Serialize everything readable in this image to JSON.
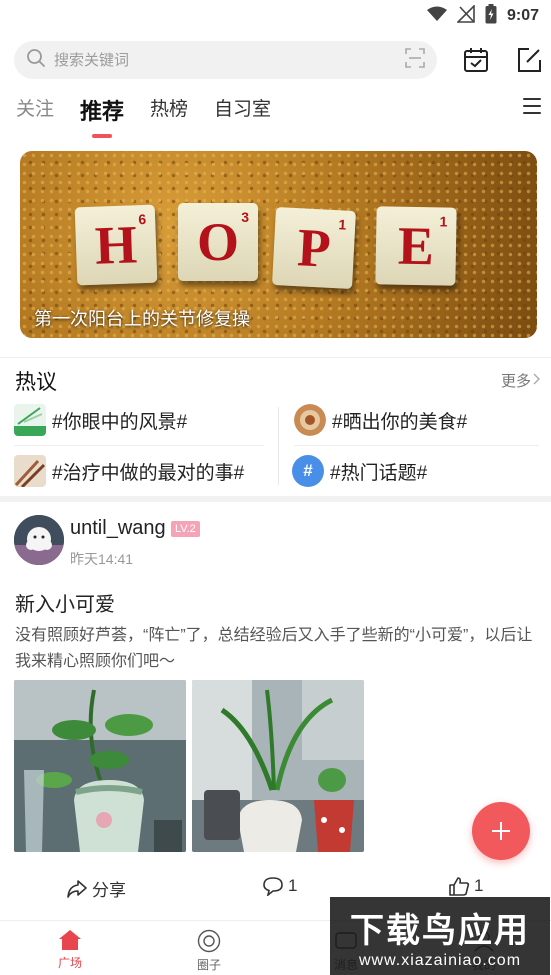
{
  "status_bar": {
    "time": "9:07"
  },
  "search": {
    "placeholder": "搜索关键词"
  },
  "tabs": [
    {
      "label": "关注"
    },
    {
      "label": "推荐"
    },
    {
      "label": "热榜"
    },
    {
      "label": "自习室"
    }
  ],
  "banner": {
    "tiles": [
      "H",
      "O",
      "P",
      "E"
    ],
    "tile_numbers": [
      "6",
      "3",
      "1",
      "1"
    ],
    "caption": "第一次阳台上的关节修复操"
  },
  "hot": {
    "title": "热议",
    "more": "更多",
    "topics": [
      {
        "label": "#你眼中的风景#"
      },
      {
        "label": "#晒出你的美食#"
      },
      {
        "label": "#治疗中做的最对的事#"
      },
      {
        "label": "#热门话题#"
      }
    ]
  },
  "post": {
    "username": "until_wang",
    "level": "LV.2",
    "time": "昨天14:41",
    "title": "新入小可爱",
    "body": "没有照顾好芦荟，“阵亡”了，总结经验后又入手了些新的“小可爱”，以后让我来精心照顾你们吧～",
    "share_label": "分享",
    "comment_count": "1",
    "like_count": "1"
  },
  "bottom_nav": [
    {
      "label": "广场"
    },
    {
      "label": "圈子"
    },
    {
      "label": "消息"
    },
    {
      "label": "我的"
    }
  ],
  "watermark": {
    "main": "下载鸟应用",
    "sub": "www.xiazainiao.com"
  },
  "colors": {
    "accent": "#f0545a",
    "fab": "#f2595c",
    "badge": "#f5a3b6"
  }
}
